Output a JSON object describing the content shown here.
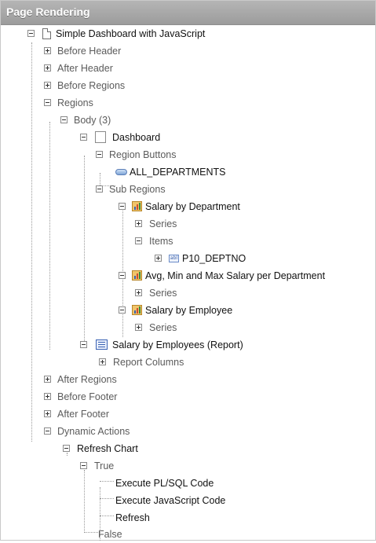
{
  "header": {
    "title": "Page Rendering"
  },
  "tree": {
    "page": "Simple Dashboard with JavaScript",
    "before_header": "Before Header",
    "after_header": "After Header",
    "before_regions": "Before Regions",
    "regions": "Regions",
    "body": "Body (3)",
    "dashboard": "Dashboard",
    "region_buttons": "Region Buttons",
    "all_departments": "ALL_DEPARTMENTS",
    "sub_regions": "Sub Regions",
    "chart1": "Salary by Department",
    "chart1_series": "Series",
    "chart1_items": "Items",
    "p10_deptno": "P10_DEPTNO",
    "chart2": "Avg, Min and Max Salary per Department",
    "chart2_series": "Series",
    "chart3": "Salary by Employee",
    "chart3_series": "Series",
    "report": "Salary by Employees (Report)",
    "report_columns": "Report Columns",
    "after_regions": "After Regions",
    "before_footer": "Before Footer",
    "after_footer": "After Footer",
    "dynamic_actions": "Dynamic Actions",
    "refresh_chart": "Refresh Chart",
    "true_branch": "True",
    "execute_plsql": "Execute PL/SQL Code",
    "execute_js": "Execute JavaScript Code",
    "refresh": "Refresh",
    "false_branch": "False"
  },
  "icons": {
    "page": "page-icon",
    "region": "region-icon",
    "button": "button-icon",
    "chart": "chart-icon",
    "item": "text-item-icon",
    "report": "report-icon"
  },
  "colors": {
    "header_bg": "#a6a6a6",
    "group_text": "#5b5b5b",
    "node_text": "#111111"
  }
}
